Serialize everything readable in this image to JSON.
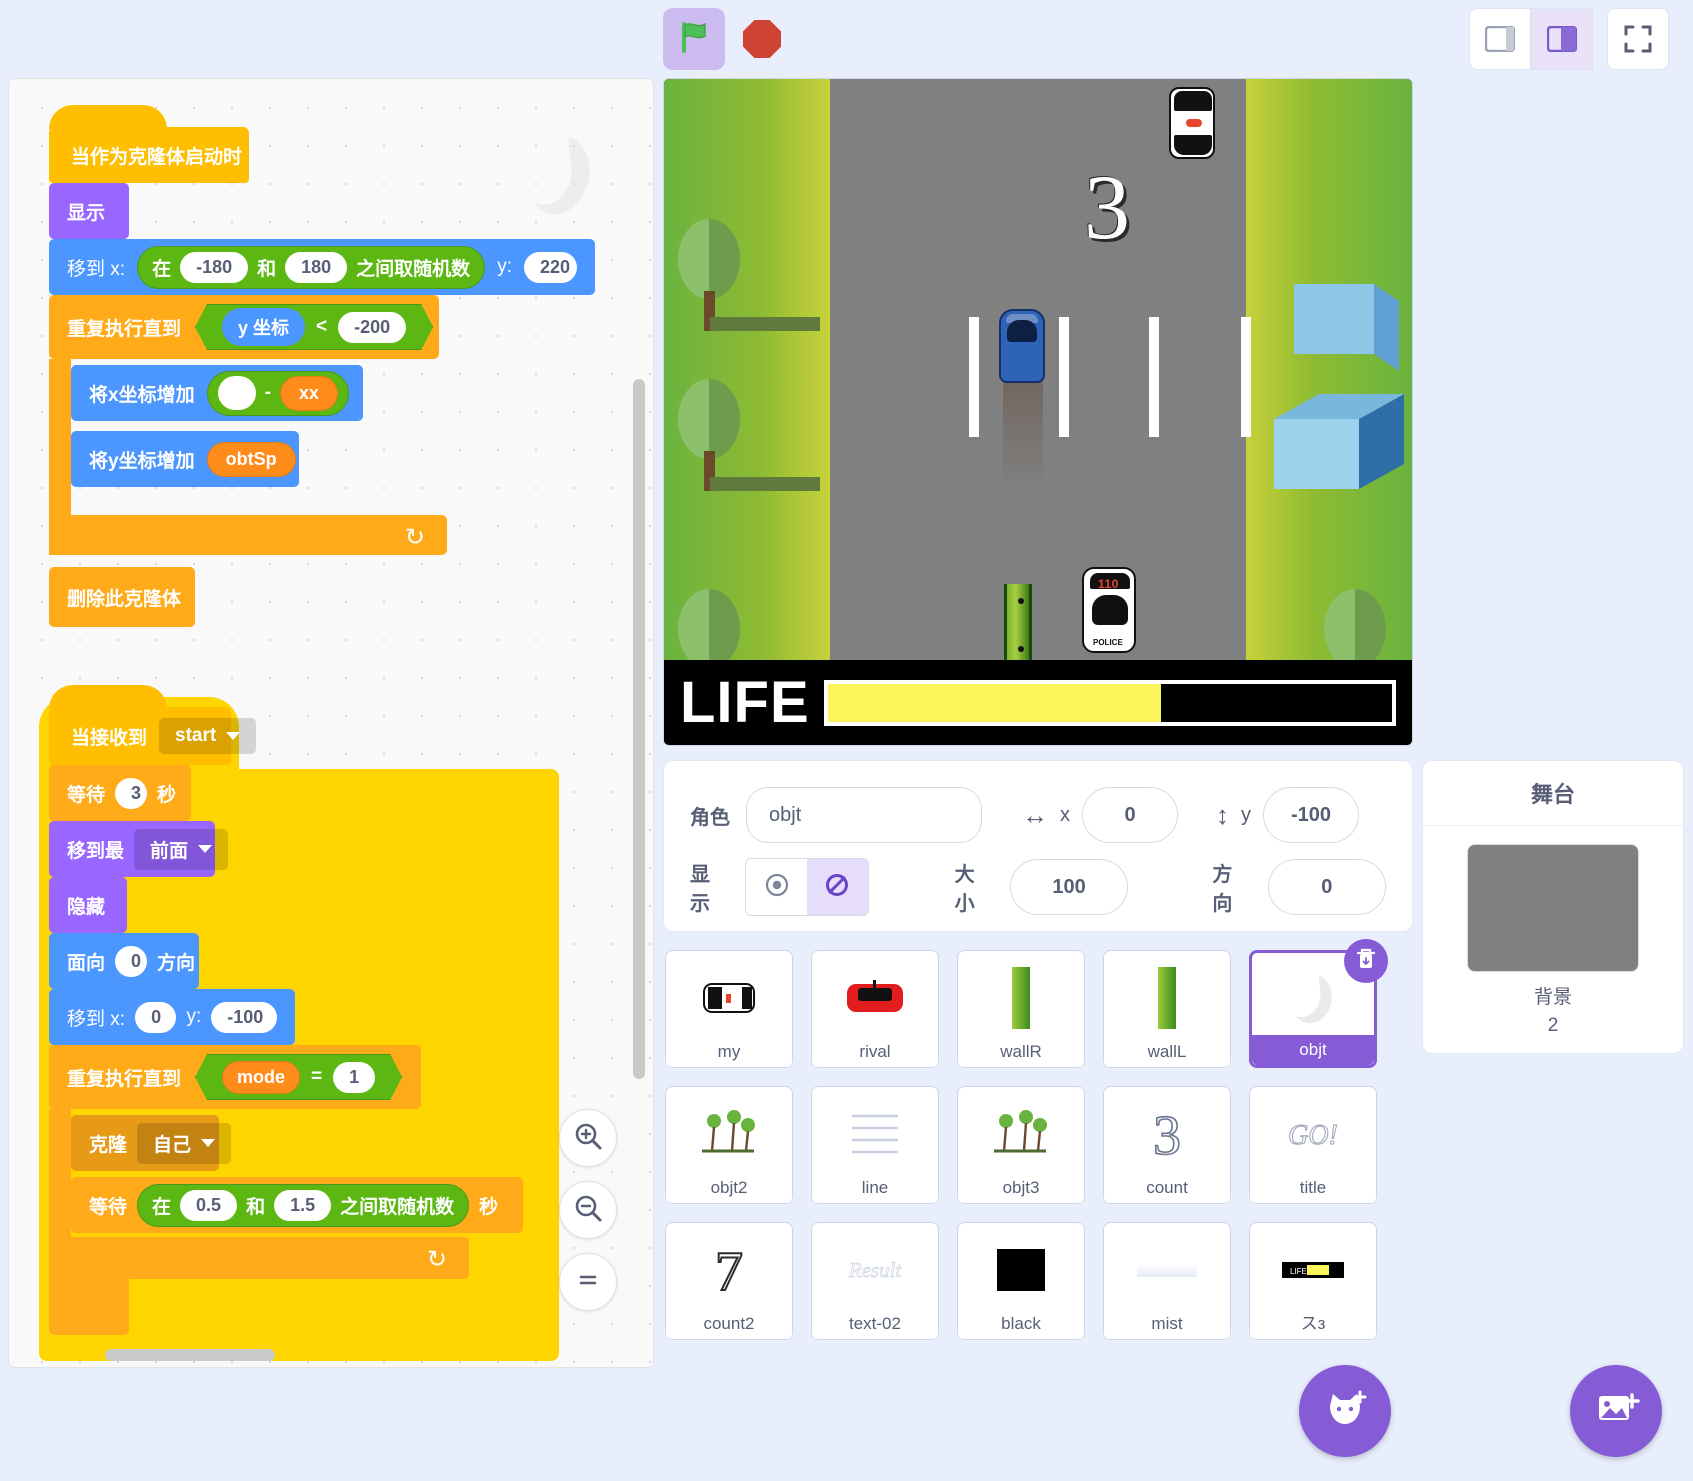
{
  "toolbar": {
    "green_flag_icon": "green-flag-icon",
    "stop_icon": "stop-sign-icon",
    "layout_small_icon": "small-stage-layout-icon",
    "layout_large_icon": "large-stage-layout-icon",
    "layout_full_icon": "fullscreen-icon"
  },
  "scripts": {
    "script1": {
      "hat": "当作为克隆体启动时",
      "show": "显示",
      "goto_label": "移到 x:",
      "rand_prefix": "在",
      "rand_min": "-180",
      "rand_and": "和",
      "rand_max": "180",
      "rand_suffix": "之间取随机数",
      "y_label": "y:",
      "y_value": "220",
      "repeat_until": "重复执行直到",
      "y_coord": "y 坐标",
      "operator_lt": "<",
      "lt_value": "-200",
      "change_x": "将x坐标增加",
      "blank_value": "",
      "minus": "-",
      "var_xx": "xx",
      "change_y": "将y坐标增加",
      "var_obtsp": "obtSp",
      "delete_clone": "删除此克隆体"
    },
    "script2": {
      "hat": "当接收到",
      "hat_dropdown": "start",
      "wait_label": "等待",
      "wait_value": "3",
      "wait_unit": "秒",
      "goto_layer": "移到最",
      "layer_dropdown": "前面",
      "hide": "隐藏",
      "point_label": "面向",
      "point_value": "0",
      "point_unit": "方向",
      "goto_label": "移到 x:",
      "goto_x": "0",
      "goto_y_label": "y:",
      "goto_y": "-100",
      "repeat_until": "重复执行直到",
      "var_mode": "mode",
      "operator_eq": "=",
      "eq_value": "1",
      "clone_label": "克隆",
      "clone_dropdown": "自己",
      "wait2_label": "等待",
      "rand_prefix": "在",
      "rand_min": "0.5",
      "rand_and": "和",
      "rand_max": "1.5",
      "rand_suffix": "之间取随机数",
      "wait2_unit": "秒"
    }
  },
  "zoom_controls": {
    "zoom_in": "zoom-in-icon",
    "zoom_out": "zoom-out-icon",
    "zoom_reset": "zoom-reset-icon"
  },
  "stage": {
    "countdown": "3",
    "life_label": "LIFE",
    "life_percent": 59,
    "police_number": "110",
    "police_text": "POLICE",
    "road_color": "#808080",
    "grass_color": "#8fbb33",
    "life_fill_color": "#fbf45a"
  },
  "sprite_info": {
    "name_label": "角色",
    "name_value": "objt",
    "x_label": "x",
    "x_value": "0",
    "y_label": "y",
    "y_value": "-100",
    "show_label": "显示",
    "show_icon": "eye-icon",
    "hide_icon": "eye-slash-icon",
    "show_selected": "hide",
    "size_label": "大小",
    "size_value": "100",
    "direction_label": "方向",
    "direction_value": "0"
  },
  "sprites": [
    {
      "name": "my",
      "type": "police-car"
    },
    {
      "name": "rival",
      "type": "red-car"
    },
    {
      "name": "wallR",
      "type": "green-bar"
    },
    {
      "name": "wallL",
      "type": "green-bar"
    },
    {
      "name": "objt",
      "type": "blank",
      "selected": true
    },
    {
      "name": "objt2",
      "type": "trees"
    },
    {
      "name": "line",
      "type": "lines"
    },
    {
      "name": "objt3",
      "type": "trees"
    },
    {
      "name": "count",
      "type": "number-3"
    },
    {
      "name": "title",
      "type": "go-text"
    },
    {
      "name": "count2",
      "type": "number-7"
    },
    {
      "name": "text-02",
      "type": "result-text"
    },
    {
      "name": "black",
      "type": "black-square"
    },
    {
      "name": "mist",
      "type": "white-bar"
    },
    {
      "name": "スз",
      "type": "life-bar"
    }
  ],
  "sprite_actions": {
    "delete_icon": "trash-icon",
    "add_sprite_icon": "add-sprite-cat-icon"
  },
  "stage_pane": {
    "title": "舞台",
    "backdrops_label": "背景",
    "backdrops_count": "2",
    "add_backdrop_icon": "add-backdrop-image-icon",
    "thumb_color": "#808080"
  }
}
